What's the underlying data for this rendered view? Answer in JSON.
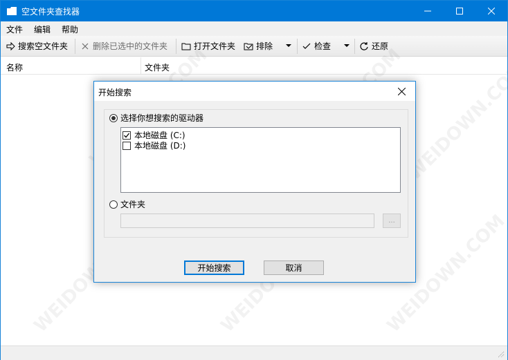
{
  "window": {
    "title": "空文件夹查找器"
  },
  "menu": {
    "items": [
      "文件",
      "编辑",
      "帮助"
    ]
  },
  "toolbar": {
    "search_label": "搜索空文件夹",
    "delete_label": "删除已选中的文件夹",
    "open_label": "打开文件夹",
    "exclude_label": "排除",
    "check_label": "检查",
    "restore_label": "还原"
  },
  "list": {
    "columns": [
      "名称",
      "文件夹"
    ]
  },
  "dialog": {
    "title": "开始搜索",
    "option_drives": "选择你想搜索的驱动器",
    "drives": [
      {
        "label": "本地磁盘 (C:)",
        "checked": true
      },
      {
        "label": "本地磁盘 (D:)",
        "checked": false
      }
    ],
    "option_folder": "文件夹",
    "folder_value": "",
    "browse_label": "...",
    "start_label": "开始搜索",
    "cancel_label": "取消"
  },
  "watermark": "WEIDOWN.COM",
  "colors": {
    "accent": "#0078d7",
    "panel": "#f0f0f0"
  }
}
